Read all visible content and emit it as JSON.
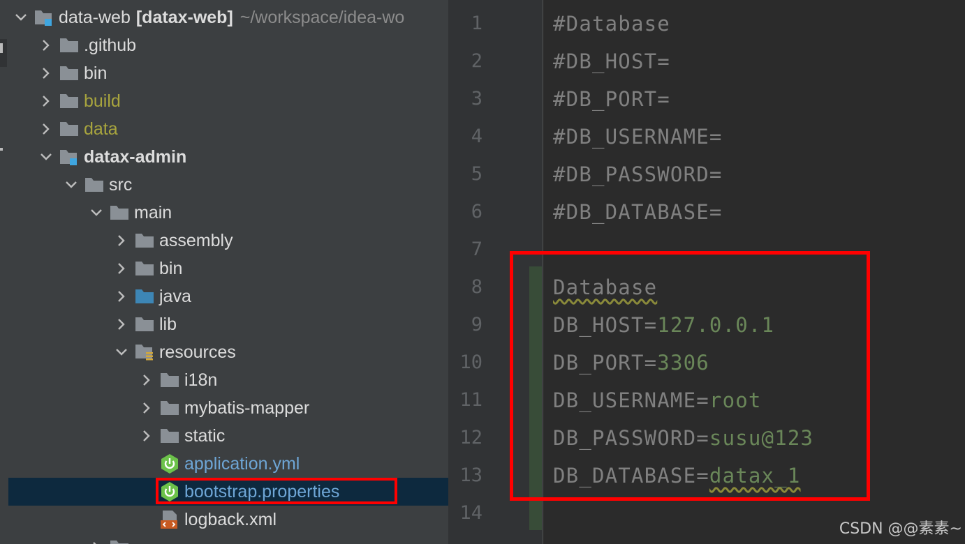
{
  "tree": {
    "root": {
      "name": "data-web",
      "module": "[datax-web]",
      "path": "~/workspace/idea-wo"
    },
    "items": [
      {
        "label": ".github"
      },
      {
        "label": "bin"
      },
      {
        "label": "build"
      },
      {
        "label": "data"
      },
      {
        "label": "datax-admin"
      },
      {
        "label": "src"
      },
      {
        "label": "main"
      },
      {
        "label": "assembly"
      },
      {
        "label": "bin"
      },
      {
        "label": "java"
      },
      {
        "label": "lib"
      },
      {
        "label": "resources"
      },
      {
        "label": "i18n"
      },
      {
        "label": "mybatis-mapper"
      },
      {
        "label": "static"
      },
      {
        "label": "application.yml"
      },
      {
        "label": "bootstrap.properties"
      },
      {
        "label": "logback.xml"
      }
    ]
  },
  "editor": {
    "line_numbers": [
      "1",
      "2",
      "3",
      "4",
      "5",
      "6",
      "7",
      "8",
      "9",
      "10",
      "11",
      "12",
      "13",
      "14"
    ],
    "lines": [
      {
        "key": "#Database",
        "value": ""
      },
      {
        "key": "#DB_HOST=",
        "value": ""
      },
      {
        "key": "#DB_PORT=",
        "value": ""
      },
      {
        "key": "#DB_USERNAME=",
        "value": ""
      },
      {
        "key": "#DB_PASSWORD=",
        "value": ""
      },
      {
        "key": "#DB_DATABASE=",
        "value": ""
      },
      {
        "key": "",
        "value": ""
      },
      {
        "key": "Database",
        "value": ""
      },
      {
        "key": "DB_HOST=",
        "value": "127.0.0.1"
      },
      {
        "key": "DB_PORT=",
        "value": "3306"
      },
      {
        "key": "DB_USERNAME=",
        "value": "root"
      },
      {
        "key": "DB_PASSWORD=",
        "value": "susu@123"
      },
      {
        "key": "DB_DATABASE=",
        "value": "datax_1"
      },
      {
        "key": "",
        "value": ""
      }
    ]
  },
  "watermark": "CSDN @@素素~",
  "colors": {
    "tree_bg": "#3c3f41",
    "editor_bg": "#2b2b2b",
    "selection": "#0d293e",
    "highlight": "#ff0000",
    "value_green": "#6a8759",
    "excluded_yellow": "#a8a53e",
    "link_blue": "#6ea6d6"
  }
}
